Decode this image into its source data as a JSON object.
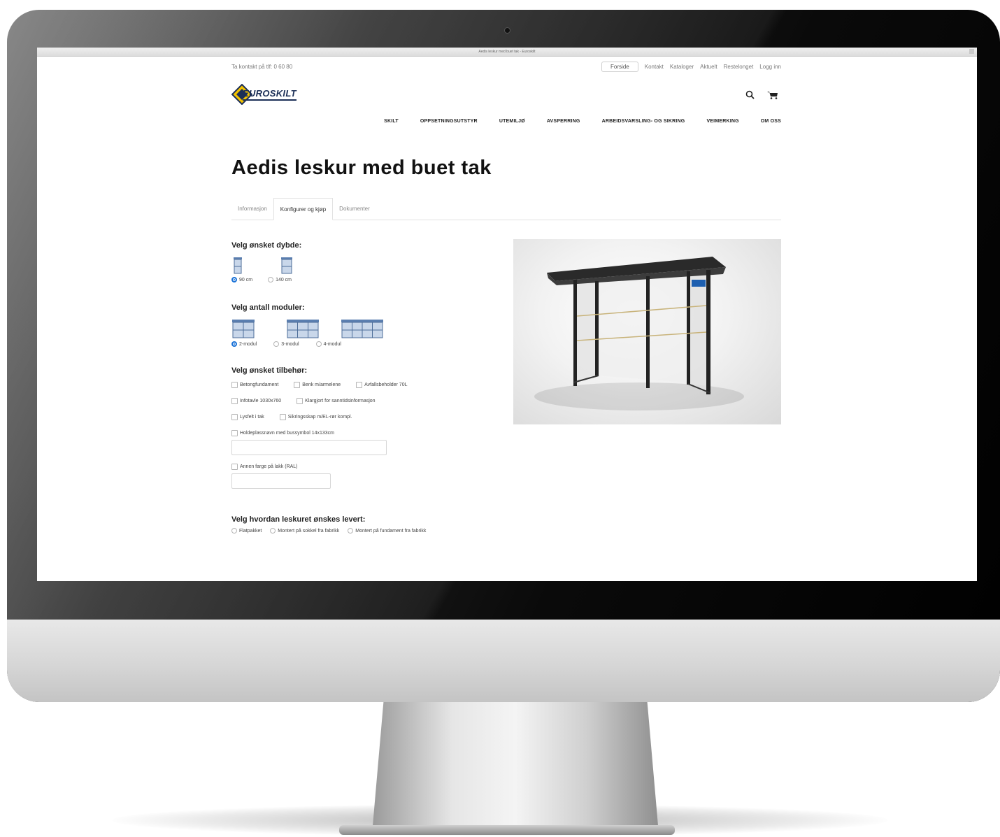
{
  "browser": {
    "window_title": "Aedis leskur med buet tak - Euroskilt"
  },
  "header": {
    "contact_text": "Ta kontakt på tlf: 0 60 80",
    "links": [
      "Forside",
      "Kontakt",
      "Kataloger",
      "Aktuelt",
      "Restelonget",
      "Logg inn"
    ],
    "logo_text": "EUROSKILT",
    "nav": [
      "SKILT",
      "OPPSETNINGSUTSTYR",
      "UTEMILJØ",
      "AVSPERRING",
      "ARBEIDSVARSLING- OG SIKRING",
      "VEIMERKING",
      "OM OSS"
    ]
  },
  "product": {
    "title": "Aedis leskur med buet tak",
    "tabs": [
      "Informasjon",
      "Konfigurer og kjøp",
      "Dokumenter"
    ],
    "active_tab": "Konfigurer og kjøp"
  },
  "config": {
    "depth": {
      "heading": "Velg ønsket dybde:",
      "options": [
        "90 cm",
        "140 cm"
      ],
      "selected": "90 cm"
    },
    "modules": {
      "heading": "Velg antall moduler:",
      "options": [
        "2-modul",
        "3-modul",
        "4-modul"
      ],
      "selected": "2-modul"
    },
    "accessories": {
      "heading": "Velg ønsket tilbehør:",
      "rows": [
        [
          "Betongfundament",
          "Benk m/armelene",
          "Avfallsbeholder 70L"
        ],
        [
          "Infotavle 1030x760",
          "Klargjort for sanntidsinformasjon"
        ],
        [
          "Lysfelt i tak",
          "Sikringsskap m/EL-rør kompl."
        ],
        [
          "Holdeplassnavn med bussymbol 14x133cm"
        ]
      ],
      "color_option": "Annen farge på lakk (RAL)"
    },
    "delivery": {
      "heading": "Velg hvordan leskuret ønskes levert:",
      "options": [
        "Flatpakket",
        "Montert på sokkel fra fabrikk",
        "Montert på fundament fra fabrikk"
      ]
    }
  },
  "colors": {
    "accent": "#1d74d8",
    "brand": "#1c2f57",
    "logo_yellow": "#f2c200"
  }
}
